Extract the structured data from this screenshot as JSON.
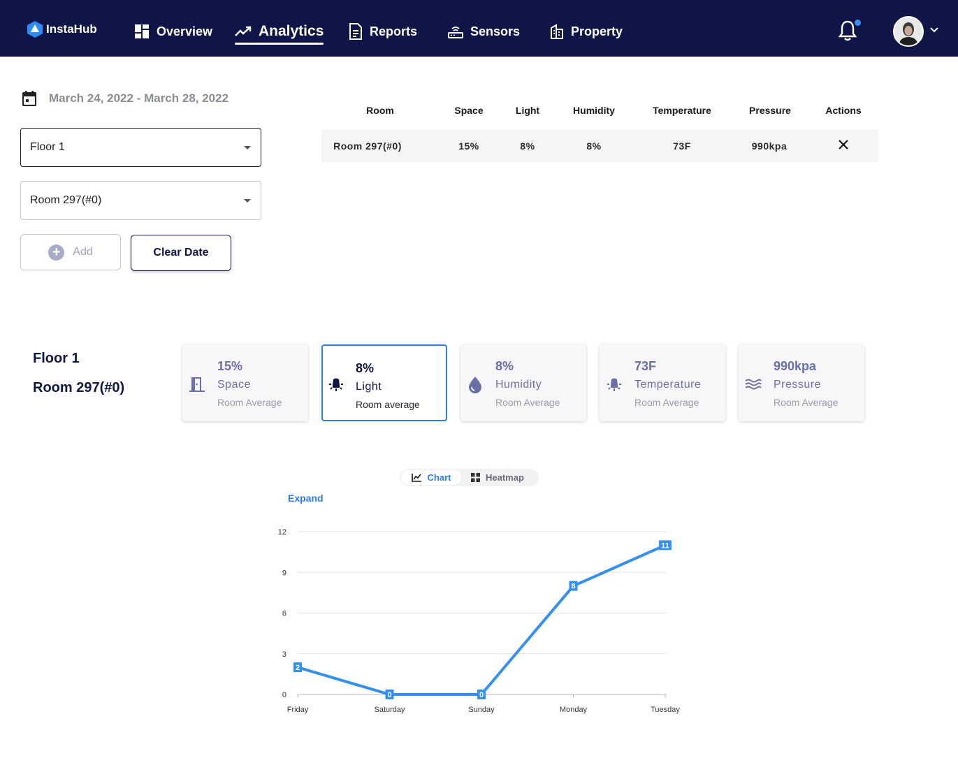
{
  "app": {
    "name": "InstaHub"
  },
  "nav": {
    "items": [
      {
        "label": "Overview",
        "icon": "dashboard-icon"
      },
      {
        "label": "Analytics",
        "icon": "trending-up-icon",
        "active": true
      },
      {
        "label": "Reports",
        "icon": "document-icon"
      },
      {
        "label": "Sensors",
        "icon": "router-icon"
      },
      {
        "label": "Property",
        "icon": "building-icon"
      }
    ],
    "notification_dot_color": "#3a8cf5",
    "bg_color": "#0f1547"
  },
  "filters": {
    "date_range": "March 24, 2022 - March 28, 2022",
    "floor_value": "Floor 1",
    "room_value": "Room 297(#0)",
    "add_label": "Add",
    "clear_date_label": "Clear Date"
  },
  "table": {
    "headers": [
      "Room",
      "Space",
      "Light",
      "Humidity",
      "Temperature",
      "Pressure",
      "Actions"
    ],
    "rows": [
      {
        "room": "Room 297(#0)",
        "space": "15%",
        "light": "8%",
        "humidity": "8%",
        "temperature": "73F",
        "pressure": "990kpa"
      }
    ]
  },
  "summary": {
    "floor": "Floor 1",
    "room": "Room 297(#0)",
    "cards": [
      {
        "value": "15%",
        "label": "Space",
        "sub": "Room Average",
        "icon": "door-icon"
      },
      {
        "value": "8%",
        "label": "Light",
        "sub": "Room average",
        "icon": "lightbulb-icon",
        "selected": true
      },
      {
        "value": "8%",
        "label": "Humidity",
        "sub": "Room Average",
        "icon": "water-drop-icon"
      },
      {
        "value": "73F",
        "label": "Temperature",
        "sub": "Room Average",
        "icon": "lightbulb-icon"
      },
      {
        "value": "990kpa",
        "label": "Pressure",
        "sub": "Room Average",
        "icon": "waves-icon"
      }
    ]
  },
  "view_toggle": {
    "chart_label": "Chart",
    "heatmap_label": "Heatmap",
    "active": "Chart"
  },
  "expand_label": "Expand",
  "chart_data": {
    "type": "line",
    "title": "",
    "xlabel": "",
    "ylabel": "",
    "categories": [
      "Friday",
      "Saturday",
      "Sunday",
      "Monday",
      "Tuesday"
    ],
    "values": [
      2,
      0,
      0,
      8,
      11
    ],
    "ylim": [
      0,
      12
    ],
    "yticks": [
      0,
      3,
      6,
      9,
      12
    ],
    "grid": true,
    "data_labels": true,
    "color": "#3390f0"
  }
}
